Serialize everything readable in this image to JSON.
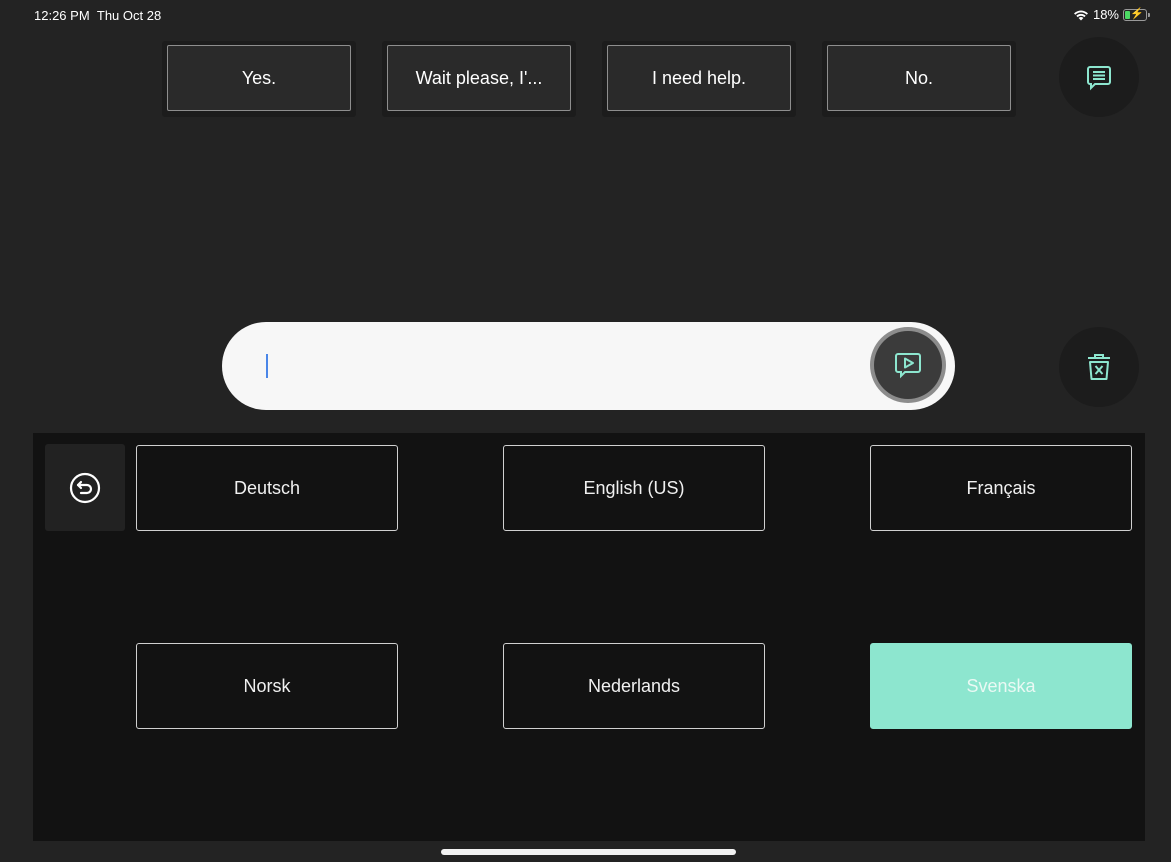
{
  "status_bar": {
    "time": "12:26 PM",
    "date": "Thu Oct 28",
    "battery": "18%"
  },
  "quick_phrases": [
    {
      "label": "Yes."
    },
    {
      "label": "Wait please, I'..."
    },
    {
      "label": "I need help."
    },
    {
      "label": "No."
    }
  ],
  "input": {
    "value": ""
  },
  "languages": [
    {
      "label": "Deutsch"
    },
    {
      "label": "English (US)"
    },
    {
      "label": "Français"
    },
    {
      "label": "Norsk"
    },
    {
      "label": "Nederlands"
    },
    {
      "label": "Svenska",
      "selected": true
    }
  ],
  "colors": {
    "accent": "#8de6cf",
    "background": "#232323",
    "panel": "#121212",
    "caret": "#4a86e8"
  },
  "icons": {
    "phrases": "phrases-list-icon",
    "speak": "speak-icon",
    "clear": "trash-icon",
    "back": "back-icon"
  }
}
